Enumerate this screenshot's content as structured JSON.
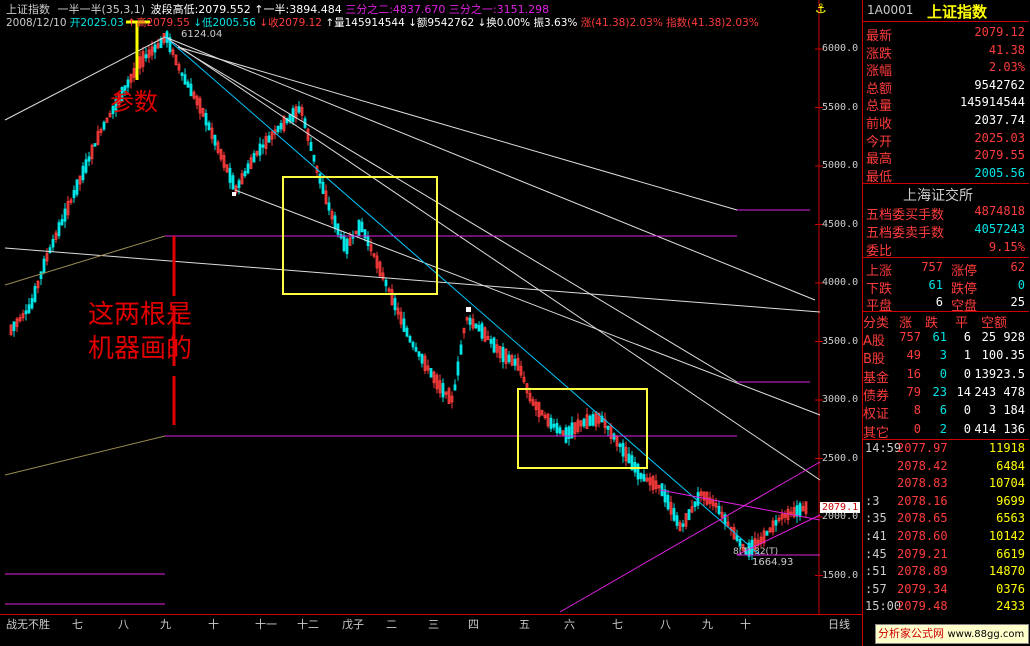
{
  "header": {
    "line1": {
      "title": "上证指数",
      "indicator": "一半一半(35,3,1)",
      "band_high_label": "波段高低:2079.552",
      "half": "↑一半:3894.484",
      "two_thirds": "三分之二:4837.670",
      "one_third": "三分之一:3151.298"
    },
    "line2": {
      "date": "2008/12/10",
      "open": "开2025.03",
      "high": "↑高2079.55",
      "low": "↓低2005.56",
      "close": "↓收2079.12",
      "volume": "↑量145914544",
      "amount": "↓额9542762",
      "turnover": "↓换0.00%",
      "amplitude": "振3.63%",
      "change": "涨(41.38)2.03%",
      "index_change": "指数(41.38)2.03%"
    }
  },
  "annotations": {
    "param_label": "参数",
    "machine_label_1": "这两根是",
    "machine_label_2": "机器画的",
    "peak_label": "6124.04",
    "low_label": "1664.93",
    "low_marks": "8(T) 32(T)",
    "current_price_tag": "2079.1"
  },
  "y_axis": [
    "6000.0",
    "5500.0",
    "5000.0",
    "4500.0",
    "4000.0",
    "3500.0",
    "3000.0",
    "2500.0",
    "2000.0",
    "1500.0"
  ],
  "x_axis": {
    "start_label": "战无不胜",
    "months": [
      "七",
      "八",
      "九",
      "十",
      "十一",
      "十二",
      "戊子",
      "二",
      "三",
      "四",
      "五",
      "六",
      "七",
      "八",
      "九",
      "十"
    ],
    "period": "日线"
  },
  "panel": {
    "code": "1A0001",
    "name": "上证指数",
    "quote_rows": [
      {
        "label": "最新",
        "value": "2079.12",
        "color": "#ff3c3c"
      },
      {
        "label": "涨跌",
        "value": "41.38",
        "color": "#ff3c3c"
      },
      {
        "label": "涨幅",
        "value": "2.03%",
        "color": "#ff3c3c"
      },
      {
        "label": "总额",
        "value": "9542762",
        "color": "#ffffff"
      },
      {
        "label": "总量",
        "value": "145914544",
        "color": "#ffffff"
      },
      {
        "label": "前收",
        "value": "2037.74",
        "color": "#ffffff"
      },
      {
        "label": "今开",
        "value": "2025.03",
        "color": "#ff3c3c"
      },
      {
        "label": "最高",
        "value": "2079.55",
        "color": "#ff3c3c"
      },
      {
        "label": "最低",
        "value": "2005.56",
        "color": "#00e5e5"
      }
    ],
    "exchange": "上海证交所",
    "order_rows": [
      {
        "label": "五档委买手数",
        "value": "4874818",
        "color": "#ff3c3c"
      },
      {
        "label": "五档委卖手数",
        "value": "4057243",
        "color": "#00e5e5"
      },
      {
        "label": "委比",
        "value": "9.15%",
        "color": "#ff3c3c"
      }
    ],
    "breadth": {
      "up_label": "上涨",
      "up": "757",
      "limit_up_label": "涨停",
      "limit_up": "62",
      "down_label": "下跌",
      "down": "61",
      "limit_down_label": "跌停",
      "limit_down": "0",
      "flat_label": "平盘",
      "flat": "6",
      "empty_label": "空盘",
      "empty": "25"
    },
    "category_headers": [
      "分类",
      "涨",
      "跌",
      "平",
      "空额"
    ],
    "categories": [
      {
        "name": "A股",
        "up": "757",
        "down": "61",
        "flat": "6",
        "amt": "25 928"
      },
      {
        "name": "B股",
        "up": "49",
        "down": "3",
        "flat": "1",
        "amt": "100.35"
      },
      {
        "name": "基金",
        "up": "16",
        "down": "0",
        "flat": "0",
        "amt": "13923.5"
      },
      {
        "name": "债券",
        "up": "79",
        "down": "23",
        "flat": "14",
        "amt": "243 478"
      },
      {
        "name": "权证",
        "up": "8",
        "down": "6",
        "flat": "0",
        "amt": "3 184"
      },
      {
        "name": "其它",
        "up": "0",
        "down": "2",
        "flat": "0",
        "amt": "414 136"
      }
    ],
    "trades": [
      {
        "time": "14:59",
        "price": "2077.97",
        "vol": "11918"
      },
      {
        "time": "",
        "price": "2078.42",
        "vol": "6484"
      },
      {
        "time": "",
        "price": "2078.83",
        "vol": "10704"
      },
      {
        "time": ":3",
        "price": "2078.16",
        "vol": "9699"
      },
      {
        "time": ":35",
        "price": "2078.65",
        "vol": "6563"
      },
      {
        "time": ":41",
        "price": "2078.60",
        "vol": "10142"
      },
      {
        "time": ":45",
        "price": "2079.21",
        "vol": "6619"
      },
      {
        "time": ":51",
        "price": "2078.89",
        "vol": "14870"
      },
      {
        "time": ":57",
        "price": "2079.34",
        "vol": "0376"
      },
      {
        "time": "15:00",
        "price": "2079.48",
        "vol": "2433"
      }
    ],
    "watermark": "分析家公式网",
    "watermark_url": "www.88gg.com"
  },
  "colors": {
    "up": "#ff3c3c",
    "down": "#00e5e5",
    "magenta": "#e020e0",
    "yellow": "#ffff00",
    "box": "#ffff40"
  }
}
